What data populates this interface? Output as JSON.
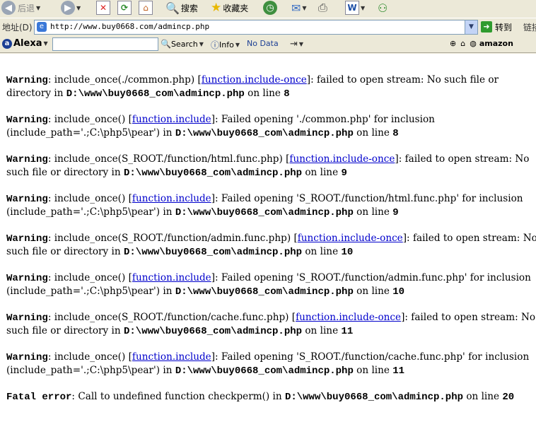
{
  "toolbar": {
    "back_label": "后退",
    "search_label": "搜索",
    "favorites_label": "收藏夹"
  },
  "address": {
    "label": "地址(D)",
    "url": "http://www.buy0668.com/admincp.php",
    "go_label": "转到",
    "links_label": "链接"
  },
  "alexa": {
    "logo": "Alexa",
    "search_label": "Search",
    "info_label": "Info",
    "nodata_label": "No Data",
    "amazon_label": "amazon"
  },
  "messages": [
    {
      "kind": "Warning",
      "pre": "include_once(./common.php) [",
      "link": "function.include-once",
      "post": "]: failed to open stream: No such file or directory in ",
      "path": "D:\\www\\buy0668_com\\admincp.php",
      "line_text": " on line ",
      "line": "8"
    },
    {
      "kind": "Warning",
      "pre": "include_once() [",
      "link": "function.include",
      "post": "]: Failed opening './common.php' for inclusion (include_path='.;C:\\php5\\pear') in ",
      "path": "D:\\www\\buy0668_com\\admincp.php",
      "line_text": " on line ",
      "line": "8"
    },
    {
      "kind": "Warning",
      "pre": "include_once(S_ROOT./function/html.func.php) [",
      "link": "function.include-once",
      "post": "]: failed to open stream: No such file or directory in ",
      "path": "D:\\www\\buy0668_com\\admincp.php",
      "line_text": " on line ",
      "line": "9"
    },
    {
      "kind": "Warning",
      "pre": "include_once() [",
      "link": "function.include",
      "post": "]: Failed opening 'S_ROOT./function/html.func.php' for inclusion (include_path='.;C:\\php5\\pear') in ",
      "path": "D:\\www\\buy0668_com\\admincp.php",
      "line_text": " on line ",
      "line": "9"
    },
    {
      "kind": "Warning",
      "pre": "include_once(S_ROOT./function/admin.func.php) [",
      "link": "function.include-once",
      "post": "]: failed to open stream: No such file or directory in ",
      "path": "D:\\www\\buy0668_com\\admincp.php",
      "line_text": " on line ",
      "line": "10"
    },
    {
      "kind": "Warning",
      "pre": "include_once() [",
      "link": "function.include",
      "post": "]: Failed opening 'S_ROOT./function/admin.func.php' for inclusion (include_path='.;C:\\php5\\pear') in ",
      "path": "D:\\www\\buy0668_com\\admincp.php",
      "line_text": " on line ",
      "line": "10"
    },
    {
      "kind": "Warning",
      "pre": "include_once(S_ROOT./function/cache.func.php) [",
      "link": "function.include-once",
      "post": "]: failed to open stream: No such file or directory in ",
      "path": "D:\\www\\buy0668_com\\admincp.php",
      "line_text": " on line ",
      "line": "11"
    },
    {
      "kind": "Warning",
      "pre": "include_once() [",
      "link": "function.include",
      "post": "]: Failed opening 'S_ROOT./function/cache.func.php' for inclusion (include_path='.;C:\\php5\\pear') in ",
      "path": "D:\\www\\buy0668_com\\admincp.php",
      "line_text": " on line ",
      "line": "11"
    },
    {
      "kind": "Fatal error",
      "pre": "Call to undefined function checkperm() in ",
      "link": "",
      "post": "",
      "path": "D:\\www\\buy0668_com\\admincp.php",
      "line_text": " on line ",
      "line": "20"
    }
  ]
}
